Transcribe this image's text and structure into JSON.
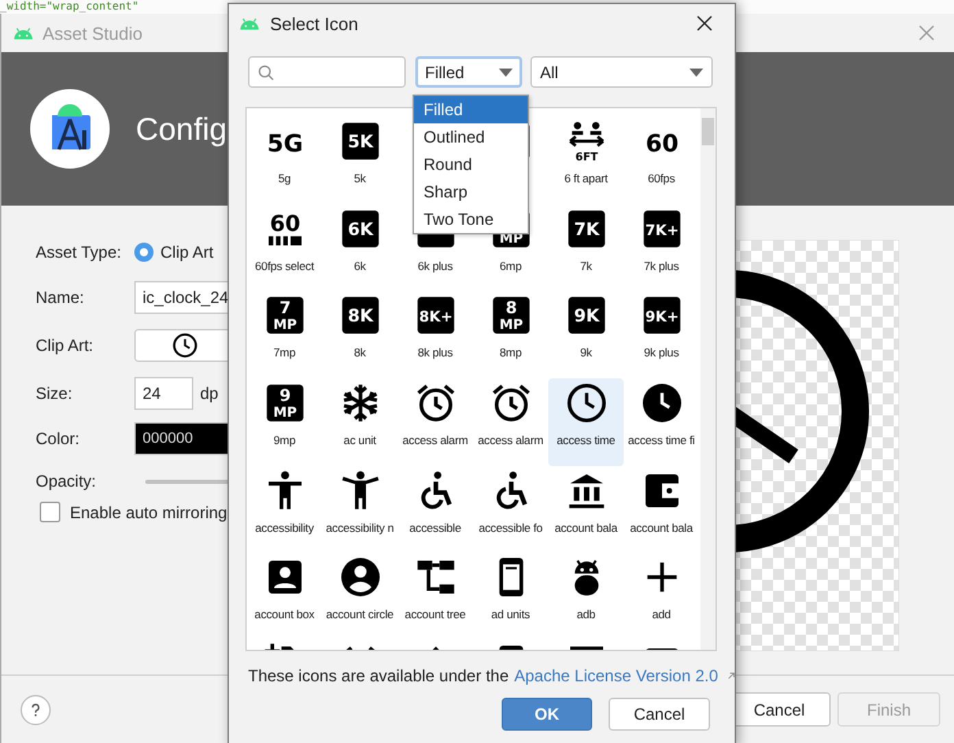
{
  "background_code": {
    "text": "_width=\"wrap_content\""
  },
  "asset_studio": {
    "title": "Asset Studio",
    "header_title": "Config",
    "form": {
      "asset_type": {
        "label": "Asset Type:",
        "options": [
          {
            "label": "Clip Art",
            "selected": true
          }
        ]
      },
      "name": {
        "label": "Name:",
        "value": "ic_clock_24"
      },
      "clip_art": {
        "label": "Clip Art:"
      },
      "size": {
        "label": "Size:",
        "value": "24",
        "unit": "dp"
      },
      "color": {
        "label": "Color:",
        "value": "000000"
      },
      "opacity": {
        "label": "Opacity:",
        "level": 1
      },
      "auto_mirroring": {
        "label": "Enable auto mirroring",
        "checked": false
      }
    },
    "buttons": [
      {
        "label": "Cancel",
        "disabled": false
      },
      {
        "label": "Finish",
        "disabled": true
      }
    ]
  },
  "select_icon": {
    "title": "Select Icon",
    "style": {
      "value": "Filled",
      "expanded": true,
      "options": [
        {
          "label": "Filled",
          "selected": true
        },
        {
          "label": "Outlined",
          "selected": false
        },
        {
          "label": "Round",
          "selected": false
        },
        {
          "label": "Sharp",
          "selected": false
        },
        {
          "label": "Two Tone",
          "selected": false
        }
      ]
    },
    "category": {
      "value": "All"
    },
    "icons": [
      {
        "kind": "text",
        "glyph": "5G",
        "label": "5g",
        "selected": false
      },
      {
        "kind": "tile",
        "glyph": "5K",
        "label": "5k",
        "selected": false
      },
      {
        "kind": "tile",
        "selected": false
      },
      {
        "kind": "social-distance",
        "glyph": "6FT",
        "label": "6 ft apart",
        "selected": false
      },
      {
        "kind": "text",
        "glyph": "60",
        "label": "60fps",
        "selected": false
      },
      {
        "kind": "text-bars",
        "glyph": "60",
        "label": "60fps select",
        "selected": false
      },
      {
        "kind": "tile",
        "glyph": "6K",
        "label": "6k",
        "selected": false
      },
      {
        "kind": "tile",
        "label": "6k plus",
        "selected": false
      },
      {
        "kind": "tile2",
        "subglyph": "MP",
        "label": "6mp",
        "selected": false
      },
      {
        "kind": "tile",
        "glyph": "7K",
        "label": "7k",
        "selected": false
      },
      {
        "kind": "tile",
        "glyph": "7K+",
        "label": "7k plus",
        "selected": false
      },
      {
        "kind": "tile2",
        "glyph": "7",
        "subglyph": "MP",
        "label": "7mp",
        "selected": false
      },
      {
        "kind": "tile",
        "glyph": "8K",
        "label": "8k",
        "selected": false
      },
      {
        "kind": "tile",
        "glyph": "8K+",
        "label": "8k plus",
        "selected": false
      },
      {
        "kind": "tile2",
        "glyph": "8",
        "subglyph": "MP",
        "label": "8mp",
        "selected": false
      },
      {
        "kind": "tile",
        "glyph": "9K",
        "label": "9k",
        "selected": false
      },
      {
        "kind": "tile",
        "glyph": "9K+",
        "label": "9k plus",
        "selected": false
      },
      {
        "kind": "tile2",
        "glyph": "9",
        "subglyph": "MP",
        "label": "9mp",
        "selected": false
      },
      {
        "kind": "snowflake",
        "label": "ac unit",
        "selected": false
      },
      {
        "kind": "alarm",
        "label": "access alarm",
        "selected": false
      },
      {
        "kind": "alarm",
        "label": "access alarm",
        "selected": false
      },
      {
        "kind": "clock",
        "label": "access time",
        "selected": true
      },
      {
        "kind": "clock-filled",
        "label": "access time fi",
        "selected": false
      },
      {
        "kind": "person",
        "label": "accessibility",
        "selected": false
      },
      {
        "kind": "person-wide",
        "label": "accessibility n",
        "selected": false
      },
      {
        "kind": "wheelchair",
        "label": "accessible",
        "selected": false
      },
      {
        "kind": "wheelchair",
        "label": "accessible fo",
        "selected": false
      },
      {
        "kind": "bank",
        "label": "account bala",
        "selected": false
      },
      {
        "kind": "wallet",
        "label": "account bala",
        "selected": false
      },
      {
        "kind": "account-box",
        "label": "account box",
        "selected": false
      },
      {
        "kind": "account-circle",
        "label": "account circle",
        "selected": false
      },
      {
        "kind": "tree",
        "label": "account tree",
        "selected": false
      },
      {
        "kind": "phone",
        "label": "ad units",
        "selected": false
      },
      {
        "kind": "android",
        "label": "adb",
        "selected": false
      },
      {
        "kind": "plus",
        "label": "add",
        "selected": false
      },
      {
        "kind": "plus-folder",
        "selected": false
      },
      {
        "kind": "alarm",
        "selected": false
      },
      {
        "kind": "pin",
        "selected": false
      },
      {
        "kind": "phone",
        "selected": false
      },
      {
        "kind": "bar",
        "selected": false
      },
      {
        "kind": "wallet",
        "selected": false
      }
    ],
    "license": {
      "text": "These icons are available under the",
      "link": "Apache License Version 2.0"
    },
    "buttons": [
      {
        "label": "OK",
        "primary": true
      },
      {
        "label": "Cancel",
        "primary": false
      }
    ]
  }
}
